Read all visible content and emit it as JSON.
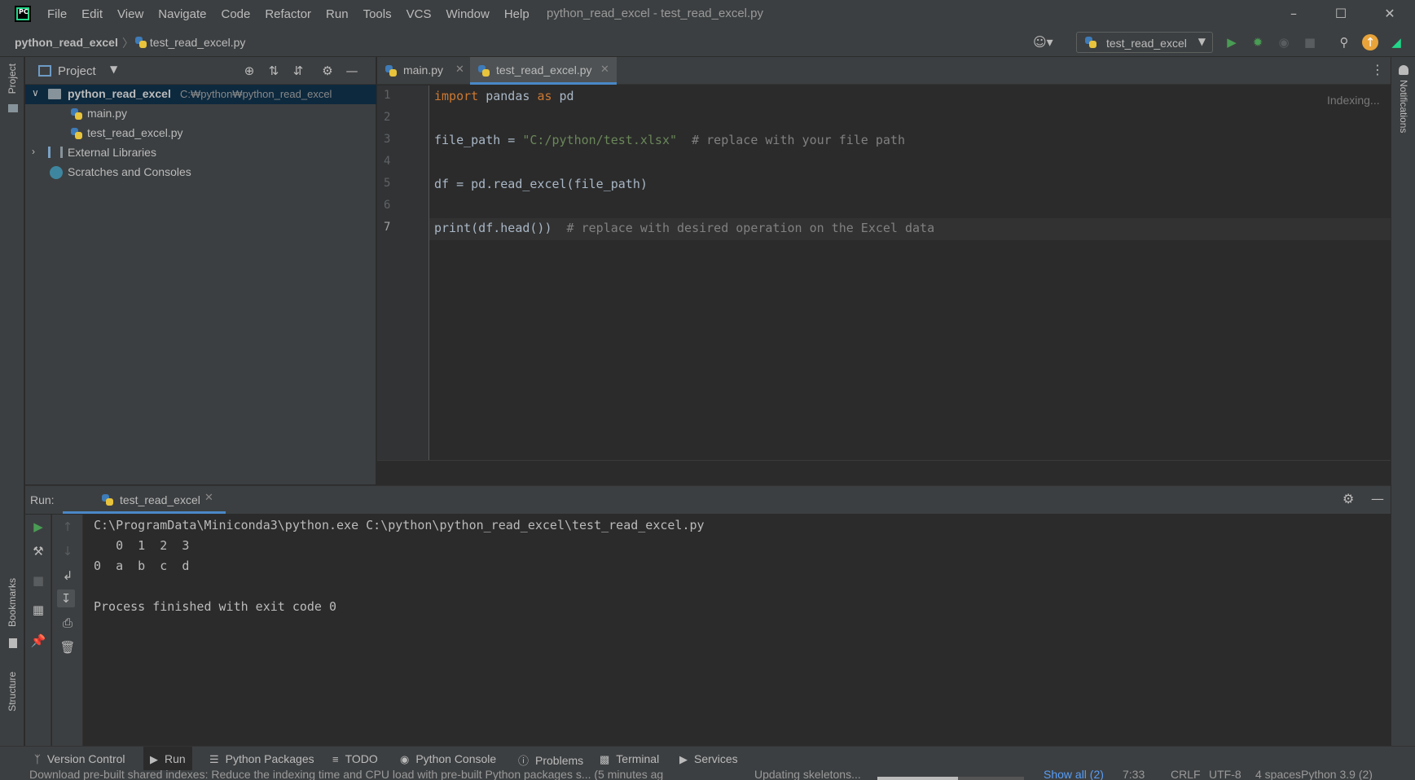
{
  "window": {
    "title": "python_read_excel - test_read_excel.py",
    "logo_text": "PC",
    "controls": [
      "–",
      "☐",
      "✕"
    ]
  },
  "menu": [
    "File",
    "Edit",
    "View",
    "Navigate",
    "Code",
    "Refactor",
    "Run",
    "Tools",
    "VCS",
    "Window",
    "Help"
  ],
  "navbar": {
    "project": "python_read_excel",
    "separator": "〉",
    "file": "test_read_excel.py",
    "run_config": "test_read_excel",
    "icons": [
      "user-icon",
      "run-icon",
      "debug-icon",
      "coverage-icon",
      "stop-icon",
      "search-icon",
      "update-icon",
      "toolbox-icon"
    ]
  },
  "left_strip": {
    "project_label": "Project",
    "bookmarks_label": "Bookmarks",
    "structure_label": "Structure"
  },
  "right_strip": {
    "notifications_label": "Notifications"
  },
  "project_panel": {
    "title": "Project",
    "tree": [
      {
        "label": "python_read_excel",
        "path": "C:₩python₩python_read_excel",
        "type": "folder",
        "expanded": true
      },
      {
        "label": "main.py",
        "type": "file"
      },
      {
        "label": "test_read_excel.py",
        "type": "file"
      },
      {
        "label": "External Libraries",
        "type": "library"
      },
      {
        "label": "Scratches and Consoles",
        "type": "scratch"
      }
    ]
  },
  "editor": {
    "tabs": [
      {
        "label": "main.py",
        "active": false
      },
      {
        "label": "test_read_excel.py",
        "active": true
      }
    ],
    "status_hint": "Indexing...",
    "line_numbers": [
      "1",
      "2",
      "3",
      "4",
      "5",
      "6",
      "7"
    ],
    "current_line": 7,
    "code": {
      "l1_kw1": "import",
      "l1_mid": " pandas ",
      "l1_kw2": "as",
      "l1_end": " pd",
      "l3_start": "file_path = ",
      "l3_str": "\"C:/python/test.xlsx\"",
      "l3_cmt": "  # replace with your file path",
      "l5": "df = pd.read_excel(file_path)",
      "l7_code": "print(df.head())",
      "l7_cmt": "  # replace with desired operation on the Excel data"
    }
  },
  "run_panel": {
    "title": "Run:",
    "tab": "test_read_excel",
    "console": [
      "C:\\ProgramData\\Miniconda3\\python.exe C:\\python\\python_read_excel\\test_read_excel.py",
      "   0  1  2  3",
      "0  a  b  c  d",
      "",
      "Process finished with exit code 0"
    ]
  },
  "bottom_tools": [
    "Version Control",
    "Run",
    "Python Packages",
    "TODO",
    "Python Console",
    "Problems",
    "Terminal",
    "Services"
  ],
  "status": {
    "message": "Download pre-built shared indexes: Reduce the indexing time and CPU load with pre-built Python packages s... (5 minutes ag",
    "task": "Updating skeletons...",
    "progress": 0.55,
    "show_all": "Show all (2)",
    "position": "7:33",
    "line_sep": "CRLF",
    "encoding": "UTF-8",
    "indent": "4 spaces",
    "interpreter": "Python 3.9 (2)"
  },
  "colors": {
    "accent": "#4a88c7",
    "run_green": "#499c54",
    "keyword": "#cc7832",
    "string": "#6a8759",
    "comment": "#808080"
  }
}
